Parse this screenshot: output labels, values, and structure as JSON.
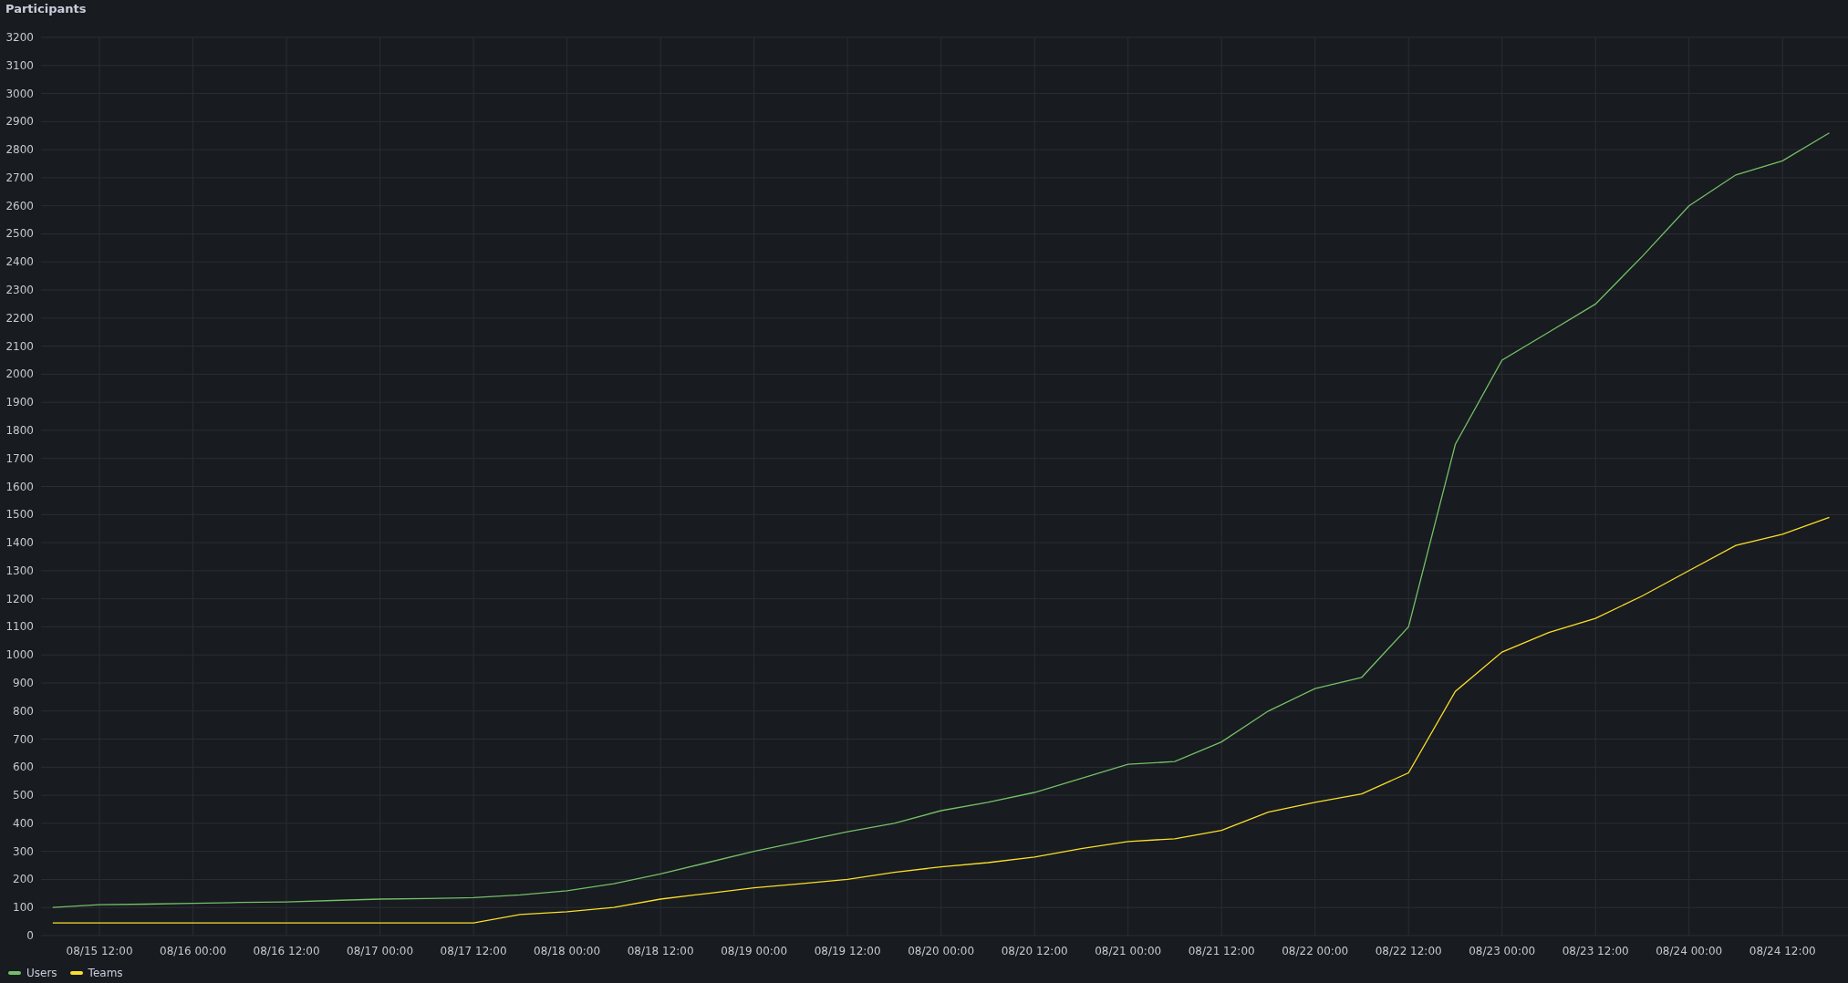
{
  "panel": {
    "title": "Participants",
    "chart_data": {
      "type": "line",
      "grid": true,
      "ylim": [
        0,
        3200
      ],
      "categories": [
        null,
        "08/15 12:00",
        null,
        "08/16 00:00",
        null,
        "08/16 12:00",
        null,
        "08/17 00:00",
        null,
        "08/17 12:00",
        null,
        "08/18 00:00",
        null,
        "08/18 12:00",
        null,
        "08/19 00:00",
        null,
        "08/19 12:00",
        null,
        "08/20 00:00",
        null,
        "08/20 12:00",
        null,
        "08/21 00:00",
        null,
        "08/21 12:00",
        null,
        "08/22 00:00",
        null,
        "08/22 12:00",
        null,
        "08/23 00:00",
        null,
        "08/23 12:00",
        null,
        "08/24 00:00",
        null,
        "08/24 12:00",
        null
      ],
      "series": [
        {
          "name": "Users",
          "color": "#73bf69",
          "values": [
            100,
            110,
            112,
            115,
            118,
            120,
            125,
            130,
            132,
            135,
            145,
            160,
            185,
            220,
            260,
            300,
            335,
            370,
            400,
            445,
            475,
            510,
            560,
            610,
            620,
            690,
            800,
            880,
            920,
            1100,
            1750,
            2050,
            2150,
            2250,
            2420,
            2600,
            2710,
            2760,
            2860
          ]
        },
        {
          "name": "Teams",
          "color": "#fade2a",
          "values": [
            45,
            45,
            45,
            45,
            45,
            45,
            45,
            45,
            45,
            45,
            75,
            85,
            100,
            130,
            150,
            170,
            185,
            200,
            225,
            245,
            260,
            280,
            310,
            335,
            345,
            375,
            440,
            475,
            505,
            580,
            870,
            1010,
            1080,
            1130,
            1210,
            1300,
            1390,
            1430,
            1490
          ]
        }
      ],
      "yticks": [
        0,
        100,
        200,
        300,
        400,
        500,
        600,
        700,
        800,
        900,
        1000,
        1100,
        1200,
        1300,
        1400,
        1500,
        1600,
        1700,
        1800,
        1900,
        2000,
        2100,
        2200,
        2300,
        2400,
        2500,
        2600,
        2700,
        2800,
        2900,
        3000,
        3100,
        3200
      ]
    }
  }
}
